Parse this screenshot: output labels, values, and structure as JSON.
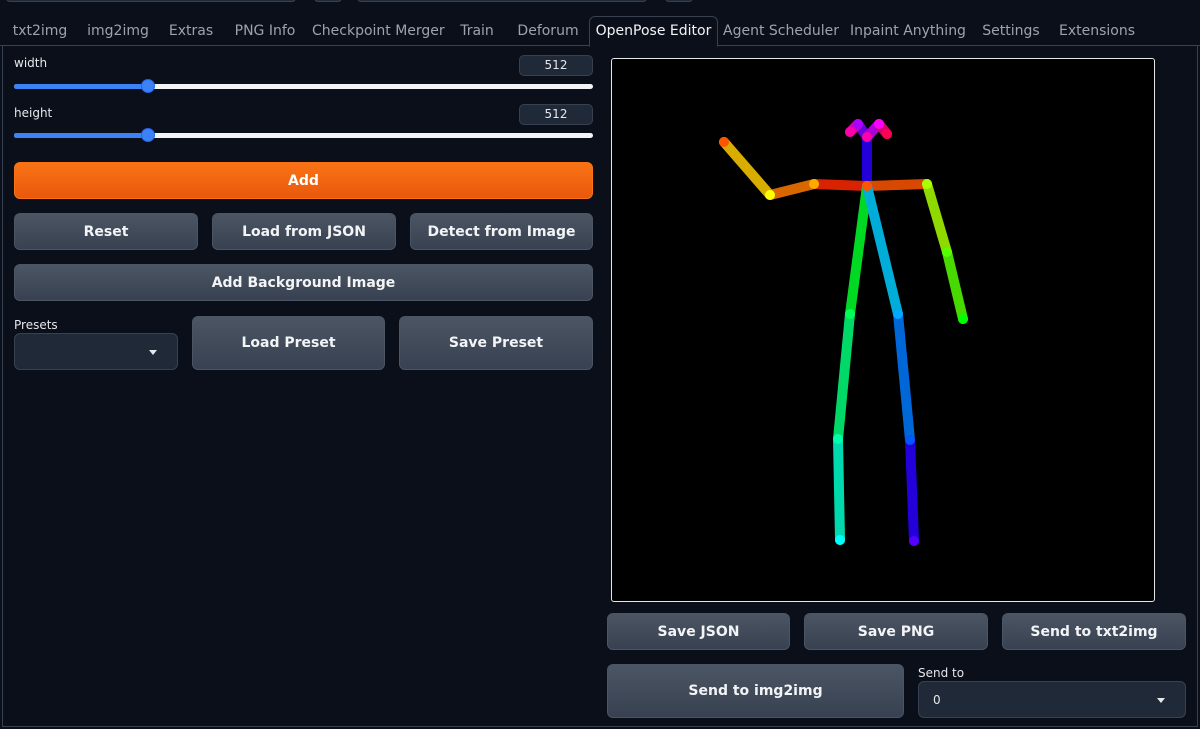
{
  "tabs": [
    {
      "label": "txt2img",
      "active": false
    },
    {
      "label": "img2img",
      "active": false
    },
    {
      "label": "Extras",
      "active": false
    },
    {
      "label": "PNG Info",
      "active": false
    },
    {
      "label": "Checkpoint Merger",
      "active": false
    },
    {
      "label": "Train",
      "active": false
    },
    {
      "label": "Deforum",
      "active": false
    },
    {
      "label": "OpenPose Editor",
      "active": true
    },
    {
      "label": "Agent Scheduler",
      "active": false
    },
    {
      "label": "Inpaint Anything",
      "active": false
    },
    {
      "label": "Settings",
      "active": false
    },
    {
      "label": "Extensions",
      "active": false
    }
  ],
  "controls": {
    "width": {
      "label": "width",
      "value": "512",
      "fraction": 0.25
    },
    "height": {
      "label": "height",
      "value": "512",
      "fraction": 0.25
    }
  },
  "buttons": {
    "add": "Add",
    "reset": "Reset",
    "load_json": "Load from JSON",
    "detect_image": "Detect from Image",
    "add_bg": "Add Background Image",
    "load_preset": "Load Preset",
    "save_preset": "Save Preset",
    "save_json": "Save JSON",
    "save_png": "Save PNG",
    "send_txt2img": "Send to txt2img",
    "send_img2img": "Send to img2img"
  },
  "presets": {
    "label": "Presets",
    "value": ""
  },
  "send_to": {
    "label": "Send to",
    "value": "0"
  },
  "colors": {
    "accent": "#f97316",
    "slider": "#3b82f6",
    "background": "#0b0f19"
  }
}
